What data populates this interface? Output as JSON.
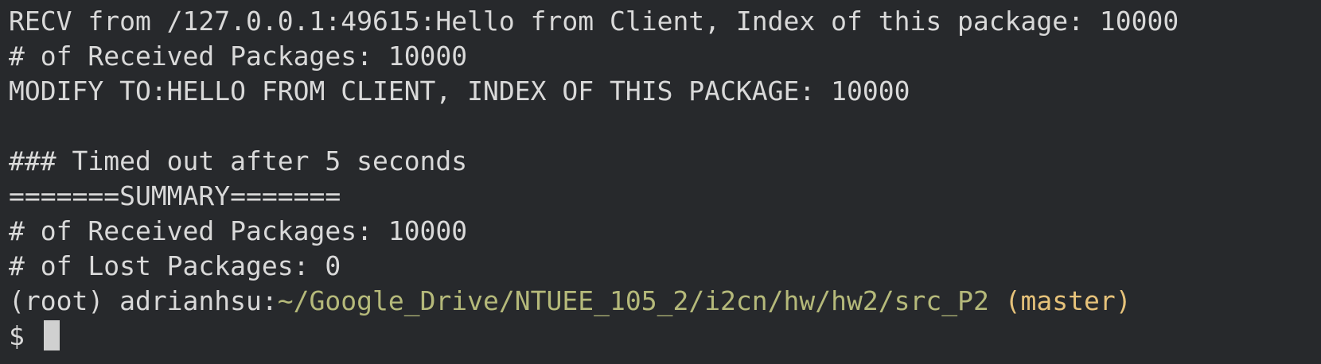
{
  "terminal": {
    "lines": [
      "RECV from /127.0.0.1:49615:Hello from Client, Index of this package: 10000",
      "# of Received Packages: 10000",
      "MODIFY TO:HELLO FROM CLIENT, INDEX OF THIS PACKAGE: 10000",
      "",
      "### Timed out after 5 seconds",
      "=======SUMMARY=======",
      "# of Received Packages: 10000",
      "# of Lost Packages: 0"
    ],
    "prompt": {
      "env": "(root) adrianhsu:",
      "path": "~/Google_Drive/NTUEE_105_2/i2cn/hw/hw2/src_P2",
      "branch": " (master)",
      "symbol": "$ "
    },
    "colors": {
      "background": "#27292c",
      "text": "#d9d9d9",
      "path": "#b5b97a",
      "branch": "#e6c27a",
      "cursor": "#d0d0d0"
    }
  }
}
